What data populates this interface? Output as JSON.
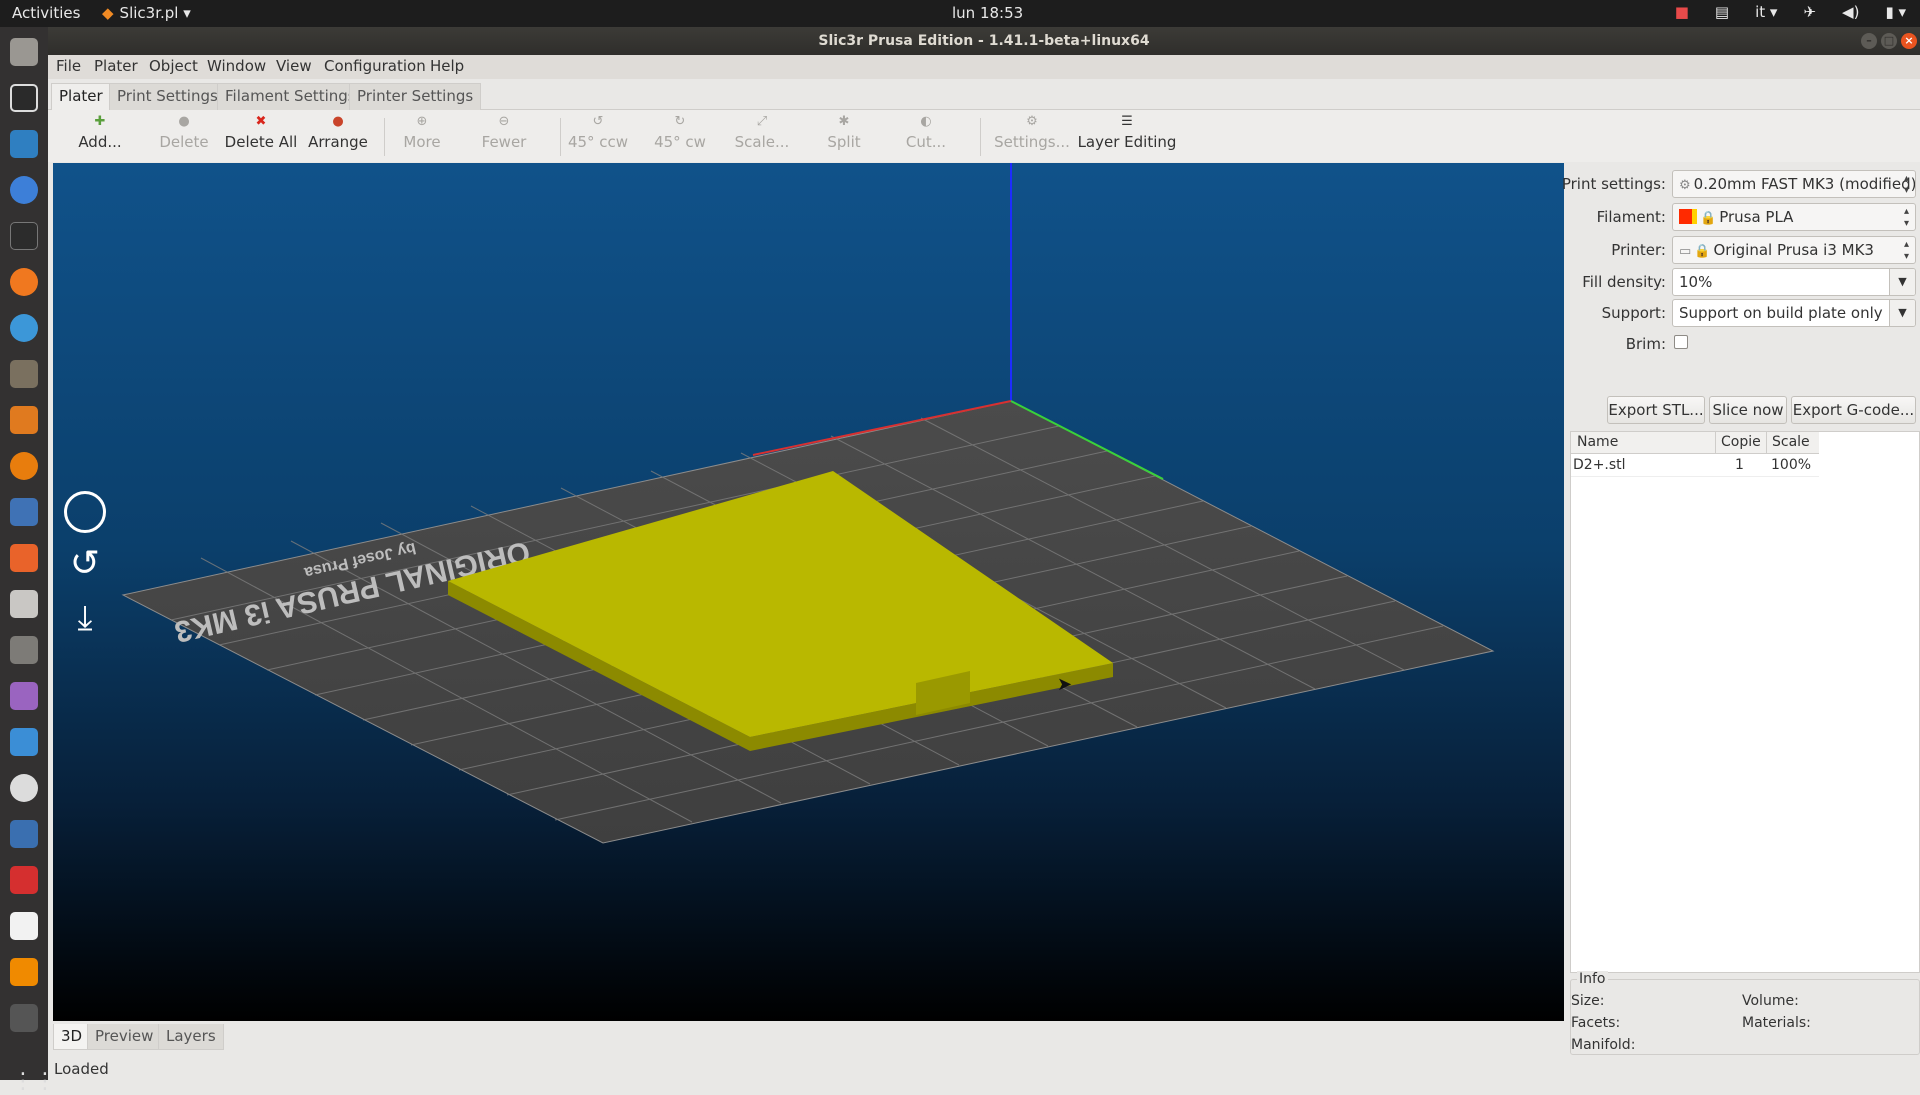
{
  "topbar": {
    "activities": "Activities",
    "app_menu": "Slic3r.pl",
    "clock": "lun 18:53",
    "keyboard_layout": "it"
  },
  "window": {
    "title": "Slic3r Prusa Edition - 1.41.1-beta+linux64"
  },
  "menu": [
    "File",
    "Plater",
    "Object",
    "Window",
    "View",
    "Configuration",
    "Help"
  ],
  "tabs": [
    "Plater",
    "Print Settings",
    "Filament Settings",
    "Printer Settings"
  ],
  "toolbar": {
    "add": "Add...",
    "delete": "Delete",
    "delete_all": "Delete All",
    "arrange": "Arrange",
    "more": "More",
    "fewer": "Fewer",
    "rot_ccw": "45° ccw",
    "rot_cw": "45° cw",
    "scale": "Scale...",
    "split": "Split",
    "cut": "Cut...",
    "settings": "Settings...",
    "layer_editing": "Layer Editing"
  },
  "bed": {
    "text_line1": "ORIGINAL PRUSA i3 MK3",
    "text_line2": "by Josef Prusa"
  },
  "settings_panel": {
    "print_label": "Print settings:",
    "print_value": "0.20mm FAST MK3 (modified)",
    "filament_label": "Filament:",
    "filament_value": "Prusa PLA",
    "filament_color": "#ff2a00",
    "printer_label": "Printer:",
    "printer_value": "Original Prusa i3 MK3",
    "fill_label": "Fill density:",
    "fill_value": "10%",
    "support_label": "Support:",
    "support_value": "Support on build plate only",
    "brim_label": "Brim:",
    "brim_checked": false
  },
  "actions": {
    "export_stl": "Export STL...",
    "slice_now": "Slice now",
    "export_gcode": "Export G-code..."
  },
  "object_list": {
    "columns": [
      "Name",
      "Copie",
      "Scale"
    ],
    "rows": [
      {
        "name": "D2+.stl",
        "copies": "1",
        "scale": "100%"
      }
    ]
  },
  "info": {
    "title": "Info",
    "size": "Size:",
    "volume": "Volume:",
    "facets": "Facets:",
    "materials": "Materials:",
    "manifold": "Manifold:"
  },
  "view_tabs": [
    "3D",
    "Preview",
    "Layers"
  ],
  "status": "Loaded",
  "colors": {
    "object": "#b9b800",
    "accent_close": "#e95420",
    "canvas_top": "#10528a"
  }
}
